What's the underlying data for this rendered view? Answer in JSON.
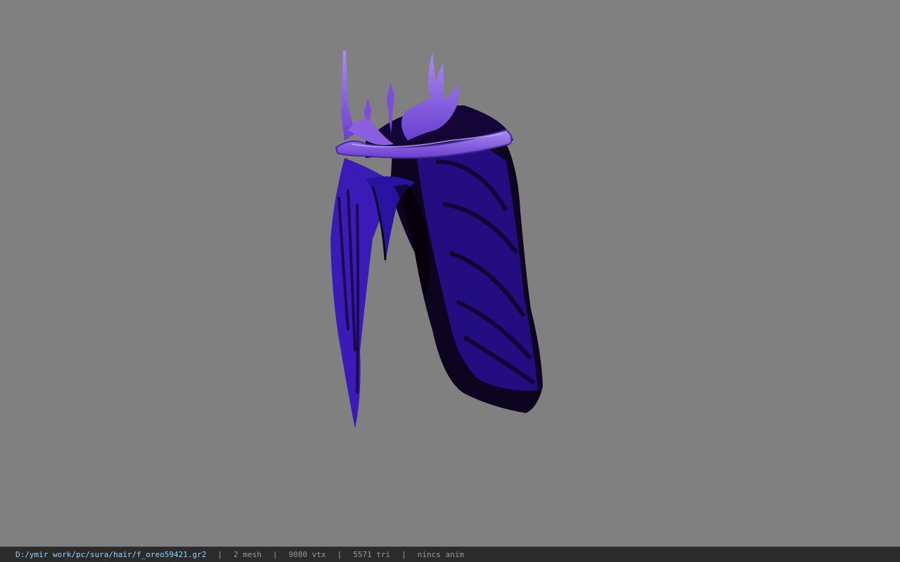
{
  "viewport": {
    "background_color": "#808080",
    "model": {
      "icon": "hair-crown-model",
      "hair_color": "#3b1bb8",
      "hair_shadow_color": "#0d0420",
      "crown_color": "#7b4fd9",
      "crown_highlight_color": "#a98cf0"
    }
  },
  "status_bar": {
    "background_color": "#2b2b2b",
    "path": "D:/ymir work/pc/sura/hair/f_oreo59421.gr2",
    "separator": "|",
    "mesh": "2 mesh",
    "vtx": "9080 vtx",
    "tri": "5571 tri",
    "anim": "nincs anim"
  }
}
